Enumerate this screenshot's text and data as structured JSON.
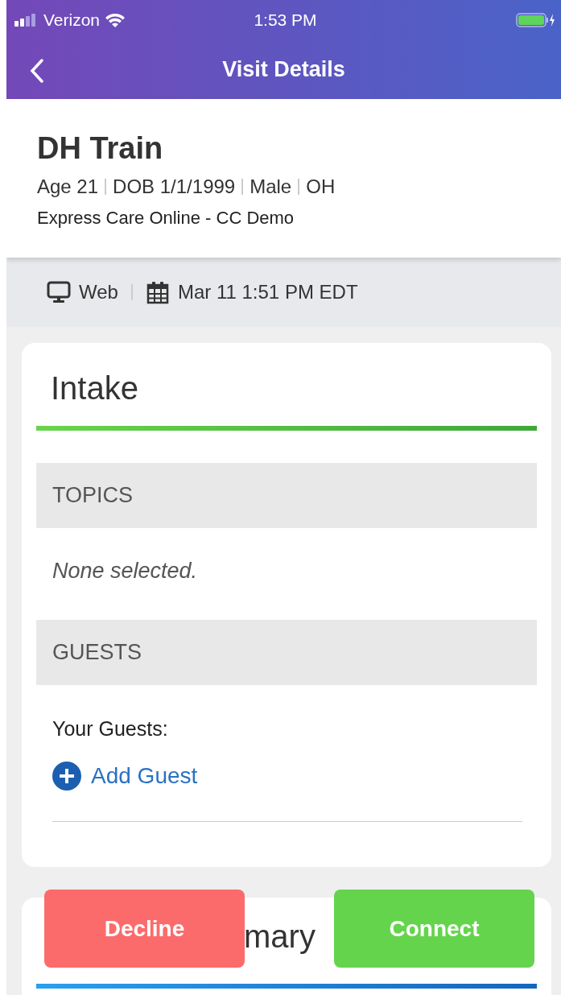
{
  "status_bar": {
    "carrier": "Verizon",
    "time": "1:53 PM"
  },
  "nav": {
    "title": "Visit Details"
  },
  "patient": {
    "name": "DH Train",
    "details": [
      "Age 21",
      "DOB 1/1/1999",
      "Male",
      "OH"
    ],
    "practice": "Express Care Online - CC Demo"
  },
  "visit_meta": {
    "channel": "Web",
    "datetime": "Mar 11 1:51 PM EDT"
  },
  "intake": {
    "title": "Intake",
    "sections": [
      {
        "kind": "empty",
        "heading": "TOPICS",
        "text": "None selected."
      },
      {
        "kind": "guests",
        "heading": "GUESTS",
        "label": "Your Guests:",
        "action": "Add Guest"
      }
    ]
  },
  "summary": {
    "title": "mary"
  },
  "actions": [
    {
      "kind": "decline",
      "label": "Decline"
    },
    {
      "kind": "connect",
      "label": "Connect"
    }
  ]
}
